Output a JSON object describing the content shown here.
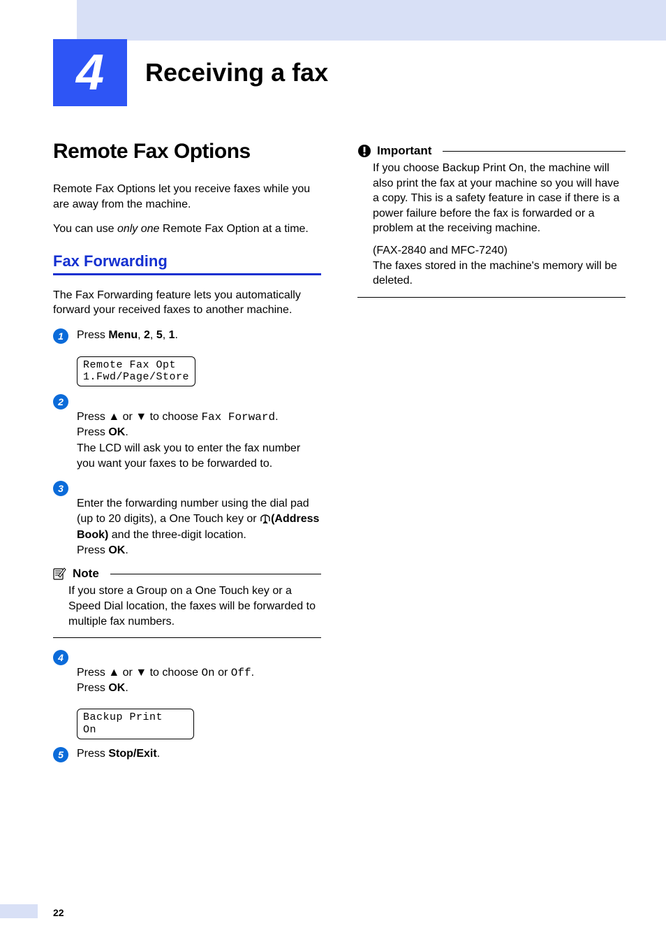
{
  "chapter": {
    "number": "4",
    "title": "Receiving a fax"
  },
  "section": {
    "title": "Remote Fax Options"
  },
  "intro": {
    "p1": "Remote Fax Options let you receive faxes while you are away from the machine.",
    "p2_a": "You can use ",
    "p2_em": "only one",
    "p2_b": " Remote Fax Option at a time."
  },
  "subsection": {
    "title": "Fax Forwarding"
  },
  "forwarding_intro": "The Fax Forwarding feature lets you automatically forward your received faxes to another machine.",
  "steps": {
    "s1": {
      "n": "1",
      "a": "Press ",
      "b1": "Menu",
      "c1": ", ",
      "b2": "2",
      "c2": ", ",
      "b3": "5",
      "c3": ", ",
      "b4": "1",
      "d": "."
    },
    "lcd1": "Remote Fax Opt\n1.Fwd/Page/Store",
    "s2": {
      "n": "2",
      "a": "Press ",
      "up": "▲",
      "mid": " or ",
      "down": "▼",
      "b": " to choose ",
      "mono": "Fax Forward",
      "c": ".\nPress ",
      "ok": "OK",
      "d": ".\nThe LCD will ask you to enter the fax number you want your faxes to be forwarded to."
    },
    "s3": {
      "n": "3",
      "a": "Enter the forwarding number using the dial pad (up to 20 digits), a One Touch key or ",
      "ab": "(Address Book)",
      "b": " and the three-digit location.\nPress ",
      "ok": "OK",
      "c": "."
    },
    "note": {
      "title": "Note",
      "body": "If you store a Group on a One Touch key or a Speed Dial location, the faxes will be forwarded to multiple fax numbers."
    },
    "s4": {
      "n": "4",
      "a": "Press ",
      "up": "▲",
      "mid": " or ",
      "down": "▼",
      "b": " to choose ",
      "on": "On",
      "or": " or ",
      "off": "Off",
      "c": ".\nPress ",
      "ok": "OK",
      "d": "."
    },
    "lcd2": "Backup Print\nOn",
    "s5": {
      "n": "5",
      "a": "Press ",
      "se": "Stop/Exit",
      "b": "."
    }
  },
  "important": {
    "title": "Important",
    "p1": "If you choose Backup Print On, the machine will also print the fax at your machine so you will have a copy. This is a safety feature in case if there is a power failure before the fax is forwarded or a problem at the receiving machine.",
    "p2": "(FAX-2840 and MFC-7240)\nThe faxes stored in the machine's memory will be deleted."
  },
  "page_number": "22"
}
